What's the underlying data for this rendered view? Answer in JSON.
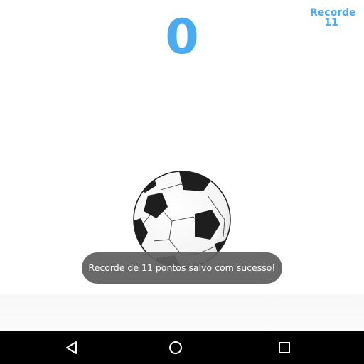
{
  "game": {
    "score": "0",
    "record_label": "Recorde",
    "record_value": "11",
    "ball_icon": "soccer-ball"
  },
  "toast": {
    "message": "Recorde de 11 pontos salvo com sucesso!"
  },
  "navigation_bar": {
    "back_icon": "triangle-back-icon",
    "home_icon": "circle-home-icon",
    "recents_icon": "square-recents-icon"
  },
  "colors": {
    "score": "#4aaaf2",
    "toast_background": "#5f5f5f",
    "navbar_background": "#000000"
  }
}
